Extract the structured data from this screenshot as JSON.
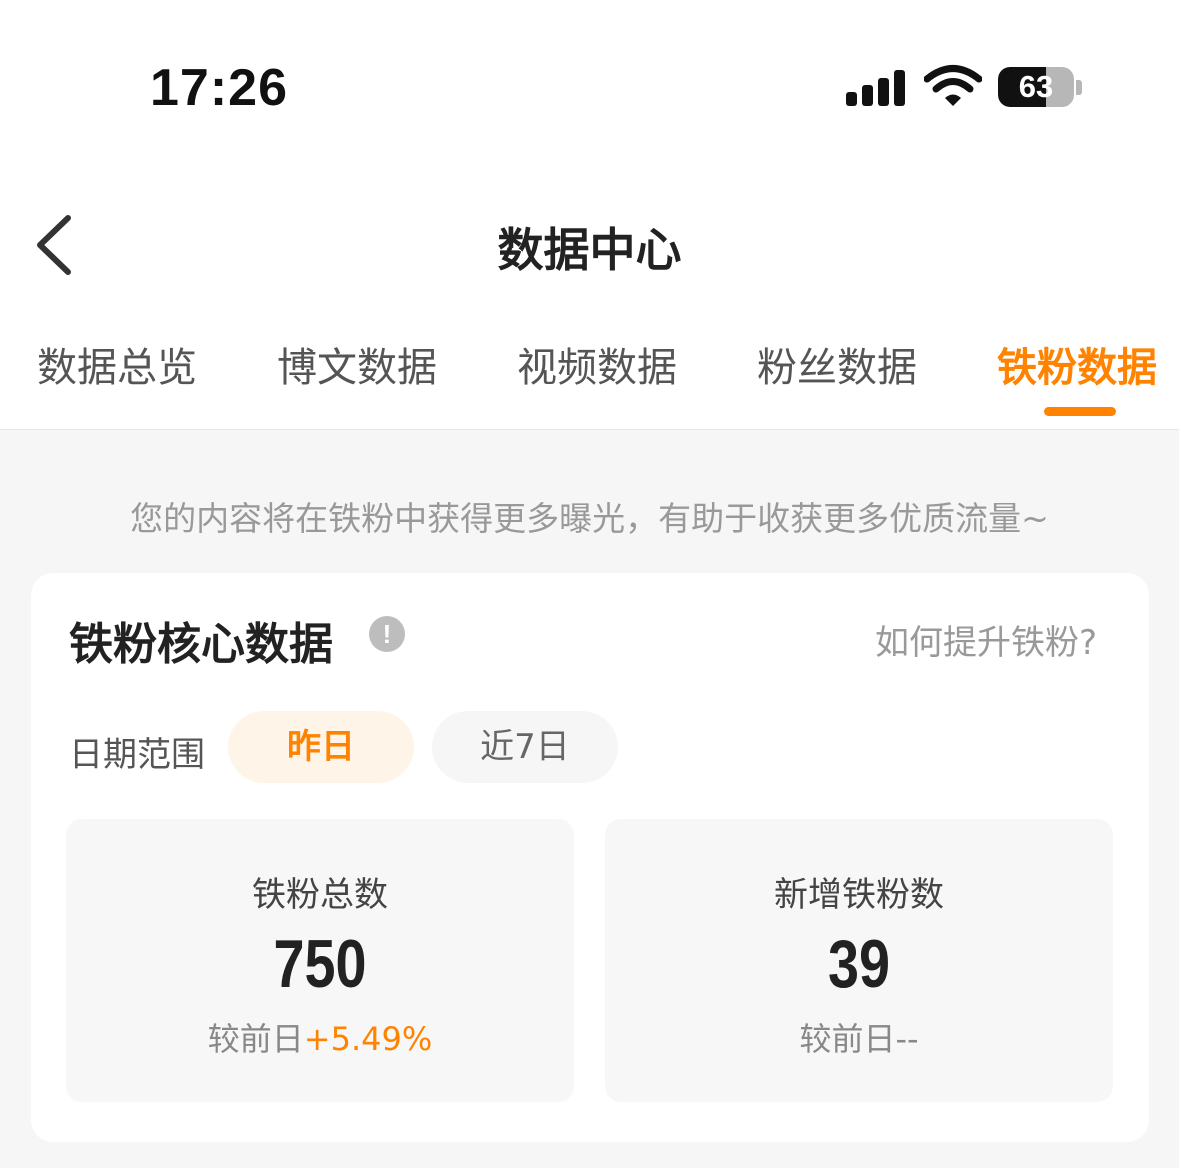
{
  "status_bar": {
    "time": "17:26",
    "battery_level": "63",
    "battery_fraction": 0.63,
    "icons": [
      "signal-icon",
      "wifi-icon",
      "battery-icon"
    ]
  },
  "nav": {
    "title": "数据中心",
    "back_icon": "chevron-left-icon"
  },
  "tabs": [
    {
      "label": "数据总览",
      "active": false
    },
    {
      "label": "博文数据",
      "active": false
    },
    {
      "label": "视频数据",
      "active": false
    },
    {
      "label": "粉丝数据",
      "active": false
    },
    {
      "label": "铁粉数据",
      "active": true
    }
  ],
  "tip": "您的内容将在铁粉中获得更多曝光，有助于收获更多优质流量~",
  "card": {
    "title": "铁粉核心数据",
    "info_icon": "info-icon",
    "help_link": "如何提升铁粉?",
    "date_range_label": "日期范围",
    "date_options": [
      {
        "label": "昨日",
        "active": true
      },
      {
        "label": "近7日",
        "active": false
      }
    ],
    "stats": [
      {
        "label": "铁粉总数",
        "value": "750",
        "compare_prefix": "较前日",
        "compare_value": "+5.49%"
      },
      {
        "label": "新增铁粉数",
        "value": "39",
        "compare_prefix": "较前日",
        "compare_value": "--"
      }
    ]
  },
  "colors": {
    "accent": "#ff8200",
    "accent_light_bg": "#fff4e8",
    "page_bg": "#f6f6f6",
    "card_bg": "#ffffff",
    "text_muted": "#999999"
  }
}
